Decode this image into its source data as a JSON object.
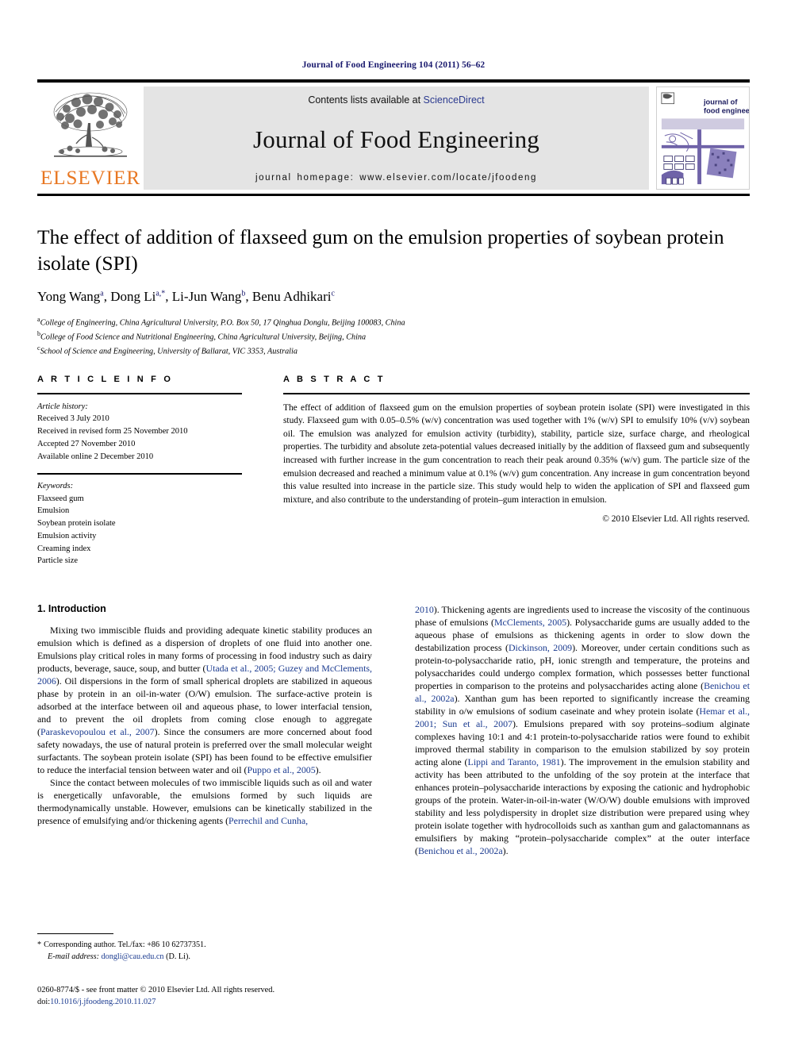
{
  "running_head": "Journal of Food Engineering 104 (2011) 56–62",
  "masthead": {
    "publisher_name": "ELSEVIER",
    "contents_prefix": "Contents lists available at ",
    "contents_link": "ScienceDirect",
    "journal_name": "Journal of Food Engineering",
    "homepage": "journal homepage: www.elsevier.com/locate/jfoodeng",
    "cover_line1": "journal of",
    "cover_line2": "food engineering"
  },
  "article": {
    "title": "The effect of addition of flaxseed gum on the emulsion properties of soybean protein isolate (SPI)",
    "authors": [
      {
        "name": "Yong Wang",
        "marks": "a"
      },
      {
        "name": "Dong Li",
        "marks": "a,*"
      },
      {
        "name": "Li-Jun Wang",
        "marks": "b"
      },
      {
        "name": "Benu Adhikari",
        "marks": "c"
      }
    ],
    "affiliations": [
      {
        "mark": "a",
        "text": "College of Engineering, China Agricultural University, P.O. Box 50, 17 Qinghua Donglu, Beijing 100083, China"
      },
      {
        "mark": "b",
        "text": "College of Food Science and Nutritional Engineering, China Agricultural University, Beijing, China"
      },
      {
        "mark": "c",
        "text": "School of Science and Engineering, University of Ballarat, VIC 3353, Australia"
      }
    ]
  },
  "article_info": {
    "heading": "A R T I C L E   I N F O",
    "history_label": "Article history:",
    "history": [
      "Received 3 July 2010",
      "Received in revised form 25 November 2010",
      "Accepted 27 November 2010",
      "Available online 2 December 2010"
    ],
    "keywords_label": "Keywords:",
    "keywords": [
      "Flaxseed gum",
      "Emulsion",
      "Soybean protein isolate",
      "Emulsion activity",
      "Creaming index",
      "Particle size"
    ]
  },
  "abstract": {
    "heading": "A B S T R A C T",
    "text": "The effect of addition of flaxseed gum on the emulsion properties of soybean protein isolate (SPI) were investigated in this study. Flaxseed gum with 0.05–0.5% (w/v) concentration was used together with 1% (w/v) SPI to emulsify 10% (v/v) soybean oil. The emulsion was analyzed for emulsion activity (turbidity), stability, particle size, surface charge, and rheological properties. The turbidity and absolute zeta-potential values decreased initially by the addition of flaxseed gum and subsequently increased with further increase in the gum concentration to reach their peak around 0.35% (w/v) gum. The particle size of the emulsion decreased and reached a minimum value at 0.1% (w/v) gum concentration. Any increase in gum concentration beyond this value resulted into increase in the particle size. This study would help to widen the application of SPI and flaxseed gum mixture, and also contribute to the understanding of protein–gum interaction in emulsion.",
    "copyright": "© 2010 Elsevier Ltd. All rights reserved."
  },
  "introduction": {
    "heading": "1. Introduction",
    "left_paragraphs": [
      {
        "segments": [
          {
            "t": "Mixing two immiscible fluids and providing adequate kinetic stability produces an emulsion which is defined as a dispersion of droplets of one fluid into another one. Emulsions play critical roles in many forms of processing in food industry such as dairy products, beverage, sauce, soup, and butter (",
            "ref": false
          },
          {
            "t": "Utada et al., 2005; Guzey and McClements, 2006",
            "ref": true
          },
          {
            "t": "). Oil dispersions in the form of small spherical droplets are stabilized in aqueous phase by protein in an oil-in-water (O/W) emulsion. The surface-active protein is adsorbed at the interface between oil and aqueous phase, to lower interfacial tension, and to prevent the oil droplets from coming close enough to aggregate (",
            "ref": false
          },
          {
            "t": "Paraskevopoulou et al., 2007",
            "ref": true
          },
          {
            "t": "). Since the consumers are more concerned about food safety nowadays, the use of natural protein is preferred over the small molecular weight surfactants. The soybean protein isolate (SPI) has been found to be effective emulsifier to reduce the interfacial tension between water and oil (",
            "ref": false
          },
          {
            "t": "Puppo et al., 2005",
            "ref": true
          },
          {
            "t": ").",
            "ref": false
          }
        ]
      },
      {
        "segments": [
          {
            "t": "Since the contact between molecules of two immiscible liquids such as oil and water is energetically unfavorable, the emulsions formed by such liquids are thermodynamically unstable. However, emulsions can be kinetically stabilized in the presence of emulsifying and/or thickening agents (",
            "ref": false
          },
          {
            "t": "Perrechil and Cunha,",
            "ref": true
          }
        ]
      }
    ],
    "right_paragraphs": [
      {
        "segments": [
          {
            "t": "2010",
            "ref": true
          },
          {
            "t": "). Thickening agents are ingredients used to increase the viscosity of the continuous phase of emulsions (",
            "ref": false
          },
          {
            "t": "McClements, 2005",
            "ref": true
          },
          {
            "t": "). Polysaccharide gums are usually added to the aqueous phase of emulsions as thickening agents in order to slow down the destabilization process (",
            "ref": false
          },
          {
            "t": "Dickinson, 2009",
            "ref": true
          },
          {
            "t": "). Moreover, under certain conditions such as protein-to-polysaccharide ratio, pH, ionic strength and temperature, the proteins and polysaccharides could undergo complex formation, which possesses better functional properties in comparison to the proteins and polysaccharides acting alone (",
            "ref": false
          },
          {
            "t": "Benichou et al., 2002a",
            "ref": true
          },
          {
            "t": "). Xanthan gum has been reported to significantly increase the creaming stability in o/w emulsions of sodium caseinate and whey protein isolate (",
            "ref": false
          },
          {
            "t": "Hemar et al., 2001; Sun et al., 2007",
            "ref": true
          },
          {
            "t": "). Emulsions prepared with soy proteins–sodium alginate complexes having 10:1 and 4:1 protein-to-polysaccharide ratios were found to exhibit improved thermal stability in comparison to the emulsion stabilized by soy protein acting alone (",
            "ref": false
          },
          {
            "t": "Lippi and Taranto, 1981",
            "ref": true
          },
          {
            "t": "). The improvement in the emulsion stability and activity has been attributed to the unfolding of the soy protein at the interface that enhances protein–polysaccharide interactions by exposing the cationic and hydrophobic groups of the protein. Water-in-oil-in-water (W/O/W) double emulsions with improved stability and less polydispersity in droplet size distribution were prepared using whey protein isolate together with hydrocolloids such as xanthan gum and galactomannans as emulsifiers by making “protein–polysaccharide complex” at the outer interface (",
            "ref": false
          },
          {
            "t": "Benichou et al., 2002a",
            "ref": true
          },
          {
            "t": ").",
            "ref": false
          }
        ]
      }
    ]
  },
  "footnotes": {
    "corresponding_star": "*",
    "corresponding_text": "Corresponding author. Tel./fax: +86 10 62737351.",
    "email_label": "E-mail address:",
    "email": "dongli@cau.edu.cn",
    "email_suffix": "(D. Li)."
  },
  "imprint": {
    "line1": "0260-8774/$ - see front matter © 2010 Elsevier Ltd. All rights reserved.",
    "doi_label": "doi:",
    "doi_value": "10.1016/j.jfoodeng.2010.11.027"
  },
  "colors": {
    "elsevier_orange": "#E87722",
    "link_blue": "#1a3a8f",
    "runhead_blue": "#1a1a6e",
    "masthead_gray": "#e4e4e4",
    "cover_purple": "#6f63a8"
  }
}
